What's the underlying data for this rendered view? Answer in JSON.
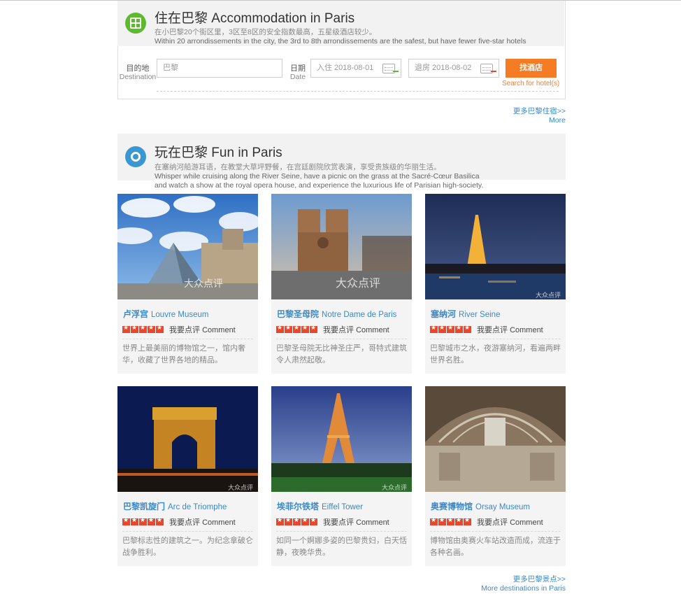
{
  "accommodation": {
    "title_zh": "住在巴黎",
    "title_en": "Accommodation in Paris",
    "subtitle_zh": "在小巴黎20个街区里，3区至8区的安全指数最高，五星级酒店较少。",
    "subtitle_en": "Within 20 arrondissements in the city, the 3rd to 8th arrondissements are the safest, but have fewer five-star hotels",
    "destination_label_zh": "目的地",
    "destination_label_en": "Destination",
    "destination_value": "巴黎",
    "date_label_zh": "日期",
    "date_label_en": "Date",
    "checkin_value": "入住 2018-08-01",
    "checkout_value": "退房 2018-08-02",
    "search_button": "找酒店",
    "search_link": "Search for hotel(s)",
    "more_zh": "更多巴黎住宿>>",
    "more_en": "More"
  },
  "fun": {
    "title_zh": "玩在巴黎",
    "title_en": "Fun in Paris",
    "subtitle_zh": "在塞纳河船游耳语，在教堂大草坪野餐，在宫廷剧院欣赏表演，享受贵族级的华丽生活。",
    "subtitle_en_1": "Whisper while cruising along the River Seine, have a picnic on the grass at the Sacré-Cœur Basilica",
    "subtitle_en_2": "and watch a show at the royal opera house, and experience the luxurious life of Parisian high-society.",
    "comment_zh": "我要点评",
    "comment_en": "Comment",
    "cards": [
      {
        "name_zh": "卢浮宫",
        "name_en": "Louvre Museum",
        "desc": "世界上最美丽的博物馆之一，馆内奢华，收藏了世界各地的精品。",
        "watermark": "大众点评",
        "stars": 5
      },
      {
        "name_zh": "巴黎圣母院",
        "name_en": "Notre Dame de Paris",
        "desc": "巴黎圣母院无比神圣庄严，哥特式建筑令人肃然起敬。",
        "watermark": "大众点评",
        "stars": 5
      },
      {
        "name_zh": "塞纳河",
        "name_en": "River Seine",
        "desc": "巴黎城市之水，夜游塞纳河，看遍两畔世界名胜。",
        "watermark": "大众点评",
        "stars": 5
      },
      {
        "name_zh": "巴黎凯旋门",
        "name_en": "Arc de Triomphe",
        "desc": "巴黎标志性的建筑之一。为纪念拿破仑战争胜利。",
        "watermark": "大众点评",
        "stars": 5
      },
      {
        "name_zh": "埃菲尔铁塔",
        "name_en": "Eiffel Tower",
        "desc": "如同一个婀娜多姿的巴黎贵妇，白天恬静，夜晚华贵。",
        "watermark": "大众点评",
        "stars": 5
      },
      {
        "name_zh": "奥赛博物馆",
        "name_en": "Orsay Museum",
        "desc": "博物馆由奥赛火车站改造而成，流连于各种名画。",
        "watermark": "大众点评",
        "stars": 5
      }
    ],
    "more_zh": "更多巴黎景点>>",
    "more_en": "More destinations in Paris"
  }
}
